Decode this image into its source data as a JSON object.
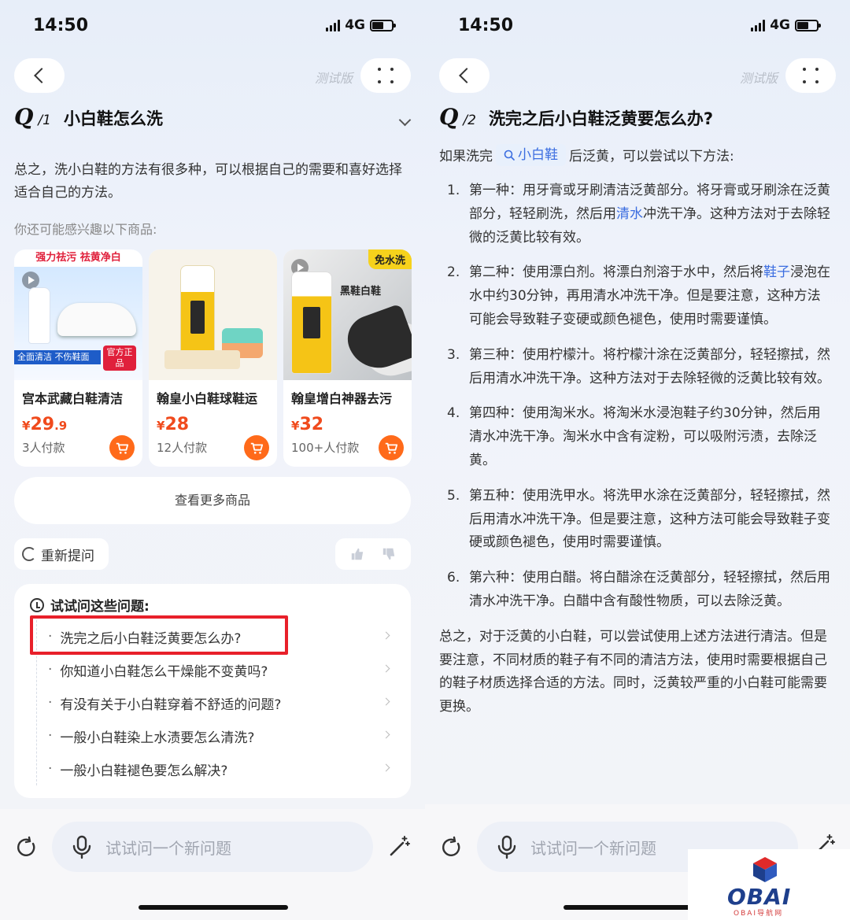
{
  "left": {
    "status": {
      "time": "14:50",
      "network": "4G"
    },
    "header": {
      "beta": "测试版"
    },
    "question": {
      "badge": "Q",
      "num": "/1",
      "text": "小白鞋怎么洗"
    },
    "summary": "总之，洗小白鞋的方法有很多种，可以根据自己的需要和喜好选择适合自己的方法。",
    "interest_label": "你还可能感兴趣以下商品:",
    "products": [
      {
        "name": "宫本武藏白鞋清洁",
        "price_yen": "¥",
        "price_int": "29",
        "price_dec": ".9",
        "sold": "3人付款",
        "banner": "强力祛污 祛黄净白",
        "strip": "全面清洁 不伤鞋面",
        "tag": "官方正品"
      },
      {
        "name": "翰皇小白鞋球鞋运",
        "price_yen": "¥",
        "price_int": "28",
        "price_dec": "",
        "sold": "12人付款"
      },
      {
        "name": "翰皇增白神器去污",
        "price_yen": "¥",
        "price_int": "32",
        "price_dec": "",
        "sold": "100+人付款",
        "badge": "免水洗",
        "label": "黑鞋白鞋"
      }
    ],
    "see_more": "查看更多商品",
    "regenerate": "重新提问",
    "suggest_title": "试试问这些问题:",
    "suggestions": [
      "洗完之后小白鞋泛黄要怎么办?",
      "你知道小白鞋怎么干燥能不变黄吗?",
      "有没有关于小白鞋穿着不舒适的问题?",
      "一般小白鞋染上水渍要怎么清洗?",
      "一般小白鞋褪色要怎么解决?"
    ],
    "input_placeholder": "试试问一个新问题"
  },
  "right": {
    "status": {
      "time": "14:50",
      "network": "4G"
    },
    "header": {
      "beta": "测试版"
    },
    "question": {
      "badge": "Q",
      "num": "/2",
      "text": "洗完之后小白鞋泛黄要怎么办?"
    },
    "intro_before": "如果洗完",
    "intro_chip": "小白鞋",
    "intro_after": "后泛黄，可以尝试以下方法:",
    "steps": [
      {
        "n": "1.",
        "a": "第一种：用牙膏或牙刷清洁泛黄部分。将牙膏或牙刷涂在泛黄部分，轻轻刷洗，然后用",
        "link": "清水",
        "b": "冲洗干净。这种方法对于去除轻微的泛黄比较有效。"
      },
      {
        "n": "2.",
        "a": "第二种：使用漂白剂。将漂白剂溶于水中，然后将",
        "link": "鞋子",
        "b": "浸泡在水中约30分钟，再用清水冲洗干净。但是要注意，这种方法可能会导致鞋子变硬或颜色褪色，使用时需要谨慎。"
      },
      {
        "n": "3.",
        "a": "第三种：使用柠檬汁。将柠檬汁涂在泛黄部分，轻轻擦拭，然后用清水冲洗干净。这种方法对于去除轻微的泛黄比较有效。",
        "link": "",
        "b": ""
      },
      {
        "n": "4.",
        "a": "第四种：使用淘米水。将淘米水浸泡鞋子约30分钟，然后用清水冲洗干净。淘米水中含有淀粉，可以吸附污渍，去除泛黄。",
        "link": "",
        "b": ""
      },
      {
        "n": "5.",
        "a": "第五种：使用洗甲水。将洗甲水涂在泛黄部分，轻轻擦拭，然后用清水冲洗干净。但是要注意，这种方法可能会导致鞋子变硬或颜色褪色，使用时需要谨慎。",
        "link": "",
        "b": ""
      },
      {
        "n": "6.",
        "a": "第六种：使用白醋。将白醋涂在泛黄部分，轻轻擦拭，然后用清水冲洗干净。白醋中含有酸性物质，可以去除泛黄。",
        "link": "",
        "b": ""
      }
    ],
    "conclusion": "总之，对于泛黄的小白鞋，可以尝试使用上述方法进行清洁。但是要注意，不同材质的鞋子有不同的清洁方法，使用时需要根据自己的鞋子材质选择合适的方法。同时，泛黄较严重的小白鞋可能需要更换。",
    "input_placeholder": "试试问一个新问题"
  },
  "watermark": {
    "text": "OBAI",
    "sub": "OBAI导航网"
  },
  "colors": {
    "accent": "#3b6de0",
    "price": "#f04a1c",
    "highlight": "#e8202a",
    "cart": "#ff6a1a"
  }
}
